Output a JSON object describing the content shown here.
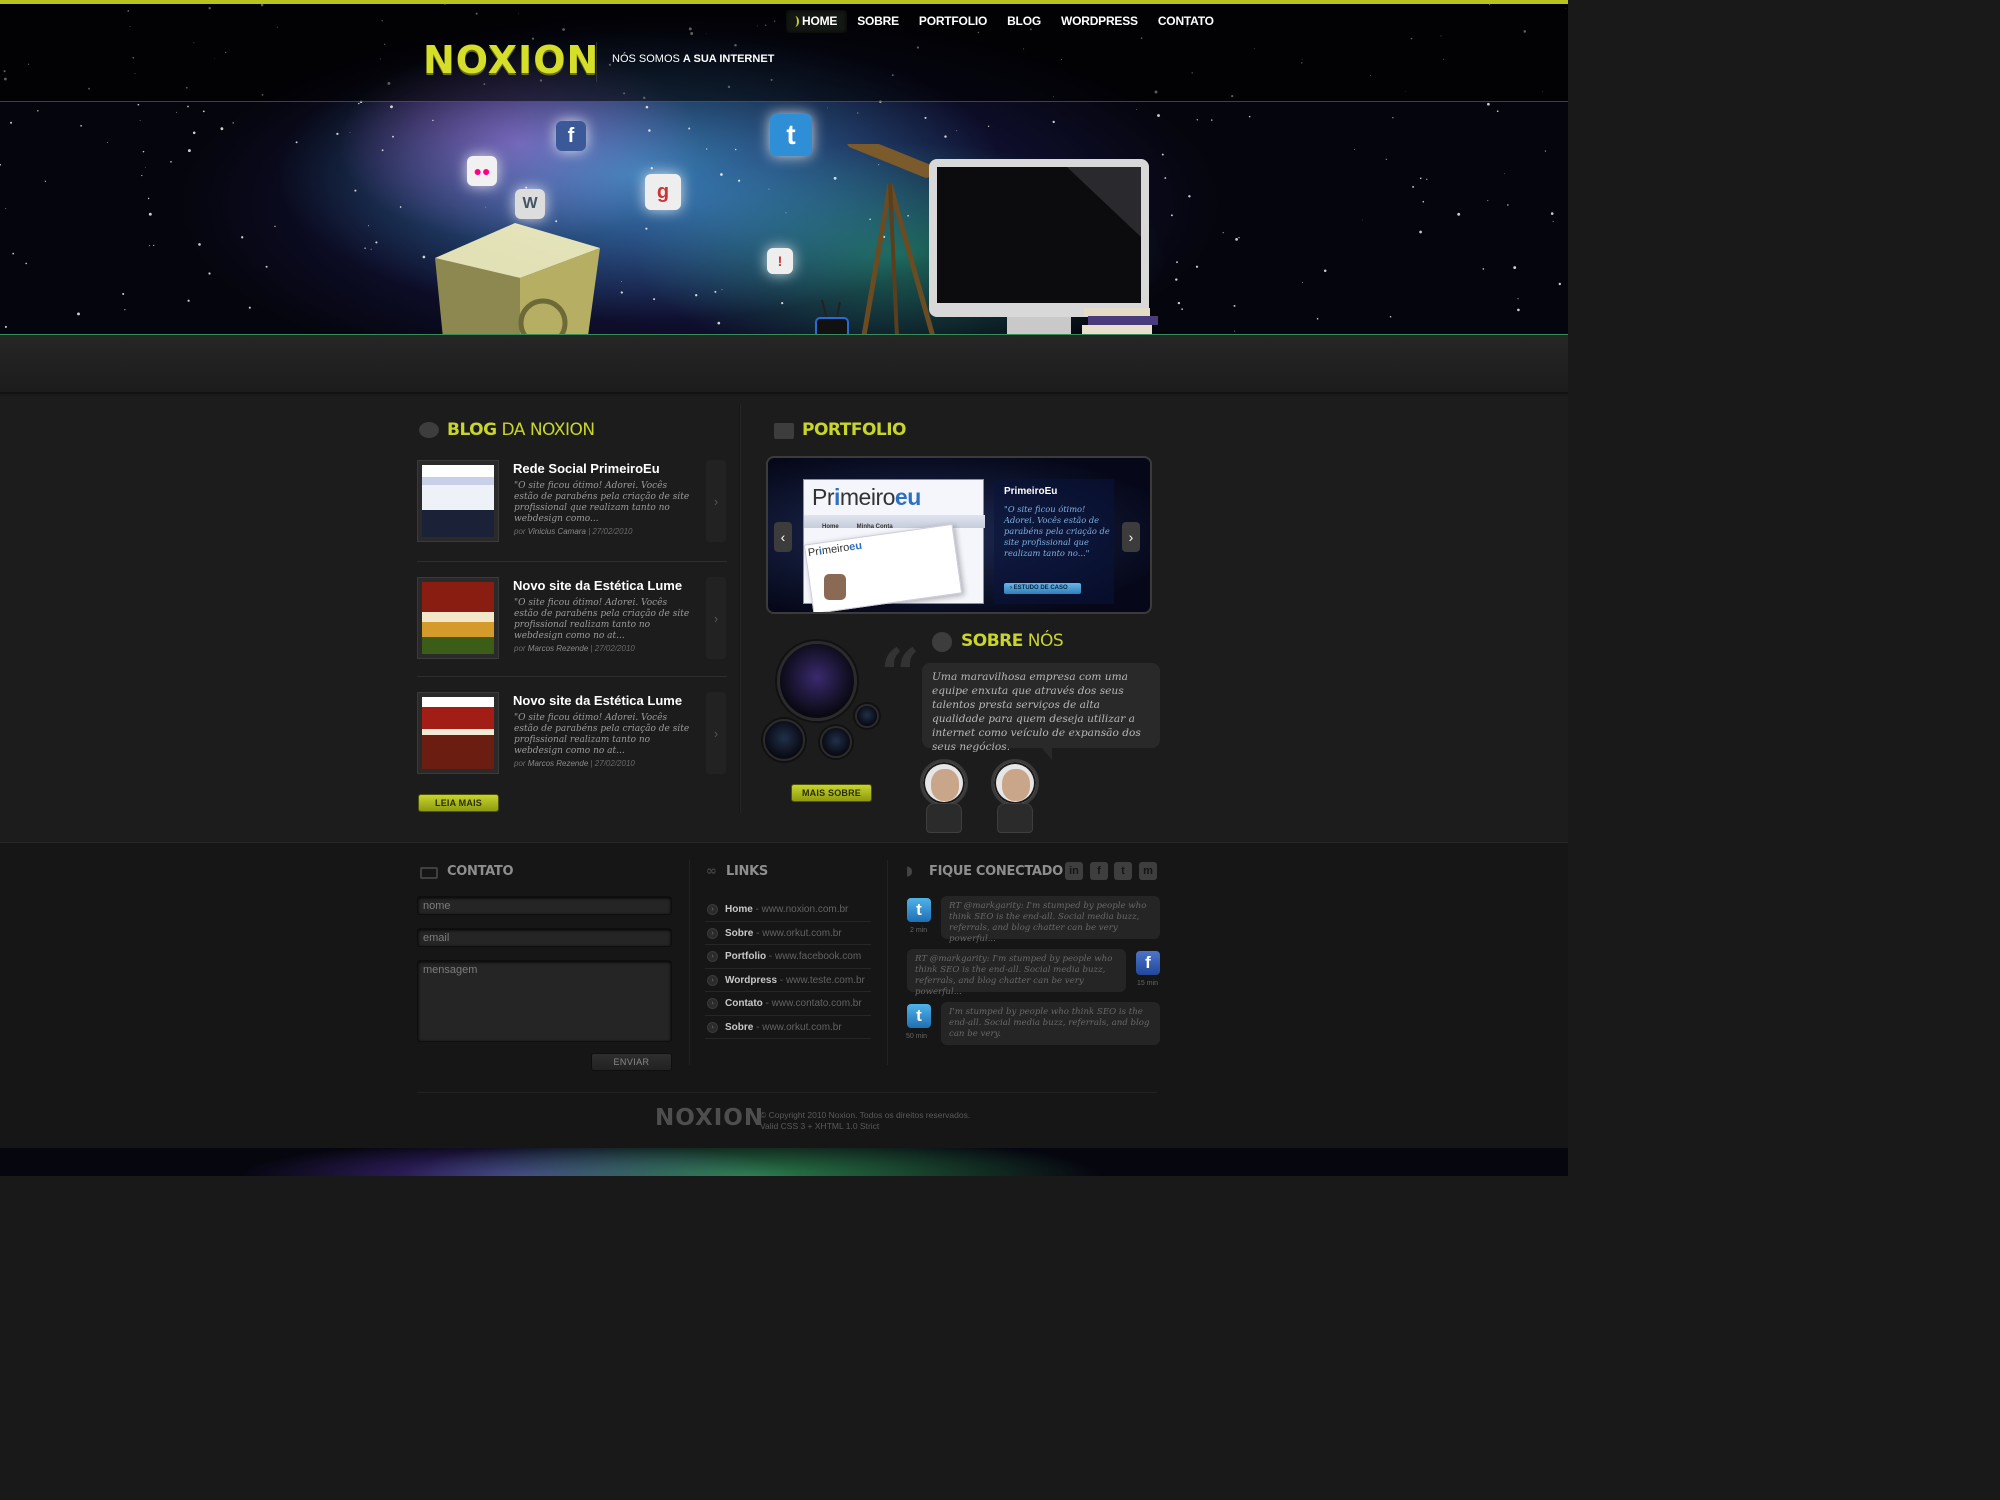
{
  "header": {
    "logo": "NOXION",
    "tagline_pre": "NÓS SOMOS ",
    "tagline_strong": "A SUA INTERNET",
    "nav": [
      {
        "label": "HOME"
      },
      {
        "label": "SOBRE"
      },
      {
        "label": "PORTFOLIO"
      },
      {
        "label": "BLOG"
      },
      {
        "label": "WORDPRESS"
      },
      {
        "label": "CONTATO"
      }
    ],
    "accent_color": "#c5d22a"
  },
  "blog": {
    "title_strong": "BLOG",
    "title_rest": " DA NOXION",
    "posts": [
      {
        "title": "Rede Social PrimeiroEu",
        "excerpt": "\"O site ficou ótimo! Adorei. Vocês estão de parabéns pela criação de site profissional que realizam tanto no webdesign como...",
        "by": "por ",
        "author": "Vinicius Camara",
        "date": " | 27/02/2010"
      },
      {
        "title": "Novo site da Estética Lume",
        "excerpt": "\"O site ficou ótimo! Adorei. Vocês estão de parabéns pela criação de site profissional realizam tanto no webdesign como no at...",
        "by": "por ",
        "author": "Marcos Rezende",
        "date": " | 27/02/2010"
      },
      {
        "title": "Novo site da Estética Lume",
        "excerpt": "\"O site ficou ótimo! Adorei. Vocês estão de parabéns pela criação de site profissional realizam tanto no webdesign como no at...",
        "by": "por ",
        "author": "Marcos Rezende",
        "date": " | 27/02/2010"
      }
    ],
    "read_more": "LEIA MAIS"
  },
  "portfolio": {
    "title": "PORTFOLIO",
    "slide": {
      "shot_logo_pre": "Pr",
      "shot_logo_i": "i",
      "shot_logo_mid": "meiro",
      "shot_logo_eu": "eu",
      "shot_nav": [
        "Home",
        "Minha Conta"
      ],
      "name": "PrimeiroEu",
      "text": "\"O site ficou ótimo! Adorei. Vocês estão de parabéns pela criação de site profissional que realizam tanto no...\"",
      "case_button": "ESTUDO DE CASO"
    }
  },
  "about": {
    "title_strong": "SOBRE",
    "title_rest": " NÓS",
    "text": "Uma maravilhosa empresa com uma equipe enxuta que através dos seus talentos presta serviços de alta qualidade para quem deseja utilizar a internet como veículo de expansão dos seus negócios.",
    "more": "MAIS SOBRE"
  },
  "contact": {
    "title": "CONTATO",
    "name_placeholder": "nome",
    "email_placeholder": "email",
    "message_placeholder": "mensagem",
    "send": "ENVIAR"
  },
  "links": {
    "title": "LINKS",
    "items": [
      {
        "label": "Home",
        "url": " - www.noxion.com.br"
      },
      {
        "label": "Sobre",
        "url": " - www.orkut.com.br"
      },
      {
        "label": "Portfolio",
        "url": " - www.facebook.com"
      },
      {
        "label": "Wordpress",
        "url": " - www.teste.com.br"
      },
      {
        "label": "Contato",
        "url": " - www.contato.com.br"
      },
      {
        "label": "Sobre",
        "url": " - www.orkut.com.br"
      }
    ]
  },
  "connect": {
    "title": "FIQUE CONECTADO",
    "social": [
      "in",
      "f",
      "t",
      "m"
    ],
    "tweets": [
      {
        "network": "twitter",
        "text": "RT @markgarity: I'm stumped by people who think SEO is the end-all. Social media buzz, referrals, and blog chatter can be very powerful...",
        "time": "2   min"
      },
      {
        "network": "facebook",
        "text": "RT @markgarity: I'm stumped by people who think SEO is the end-all. Social media buzz, referrals, and blog chatter can be very powerful...",
        "time": "15  min"
      },
      {
        "network": "twitter",
        "text": "I'm stumped by people who think SEO is the end-all. Social media buzz, referrals, and blog can be very.",
        "time": "50   min"
      }
    ]
  },
  "footer": {
    "logo": "NOXION",
    "copyright": "© Copyright 2010 Noxion. Todos os direitos reservados.",
    "valid": "Valid CSS 3 + XHTML 1.0 Strict"
  }
}
